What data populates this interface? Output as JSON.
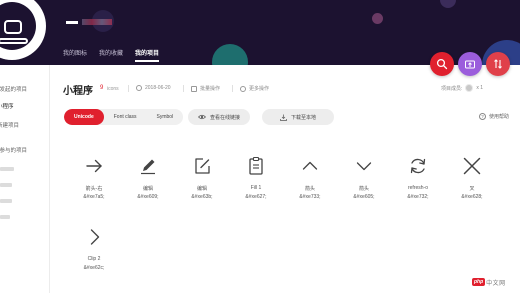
{
  "header": {
    "tabs": [
      {
        "label": "我的图标",
        "active": false
      },
      {
        "label": "我的收藏",
        "active": false
      },
      {
        "label": "我的项目",
        "active": true
      }
    ],
    "accent_color": "#e0202e"
  },
  "sidebar": {
    "section_created_title": "我发起的项目",
    "section_created_item": "小程序",
    "add_project_label": "新建项目",
    "section_joined_title": "我参与的项目"
  },
  "project": {
    "title": "小程序",
    "icon_count": "9",
    "icon_count_unit": "icons",
    "date": "2018-06-20",
    "bulk_action": "批量操作",
    "more_action": "更多操作",
    "members_label": "项目成员:",
    "members_count": "x 1"
  },
  "toolbar": {
    "font_types": [
      {
        "label": "Unicode",
        "active": true
      },
      {
        "label": "Font class",
        "active": false
      },
      {
        "label": "Symbol",
        "active": false
      }
    ],
    "view_online": "查看在线链接",
    "download": "下载至本地",
    "help": "使用帮助"
  },
  "icons": [
    {
      "name": "箭头-右",
      "code": "&#xe7a5;",
      "icon": "arrow-right-icon"
    },
    {
      "name": "编辑",
      "code": "&#xe609;",
      "icon": "pencil-icon"
    },
    {
      "name": "编辑",
      "code": "&#xe63b;",
      "icon": "edit-square-icon"
    },
    {
      "name": "Fill 1",
      "code": "&#xe627;",
      "icon": "clipboard-icon"
    },
    {
      "name": "箭头",
      "code": "&#xe733;",
      "icon": "chevron-up-icon"
    },
    {
      "name": "箭头",
      "code": "&#xe605;",
      "icon": "chevron-down-icon"
    },
    {
      "name": "refresh-o",
      "code": "&#xe732;",
      "icon": "refresh-icon"
    },
    {
      "name": "叉",
      "code": "&#xe628;",
      "icon": "close-icon"
    },
    {
      "name": "Clip 2",
      "code": "&#xe62c;",
      "icon": "chevron-right-icon"
    }
  ],
  "watermark": {
    "badge": "php",
    "text": "中文网"
  }
}
